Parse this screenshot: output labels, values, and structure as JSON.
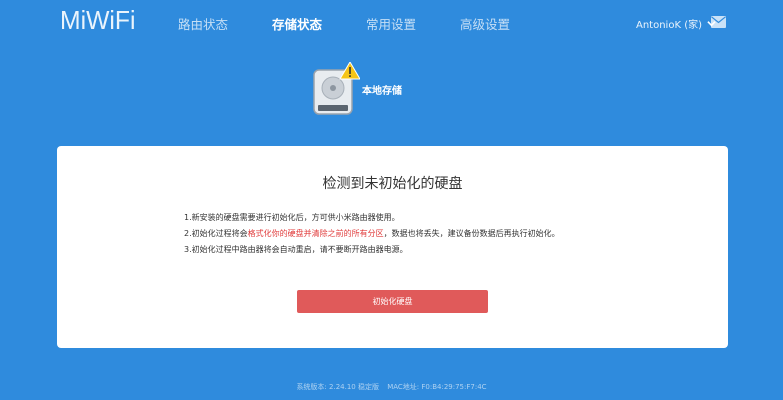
{
  "header": {
    "logo": "MiWiFi",
    "nav": [
      {
        "label": "路由状态",
        "active": false
      },
      {
        "label": "存储状态",
        "active": true
      },
      {
        "label": "常用设置",
        "active": false
      },
      {
        "label": "高级设置",
        "active": false
      }
    ],
    "user_label": "AntonioK (家)"
  },
  "storage": {
    "label": "本地存储"
  },
  "card": {
    "title": "检测到未初始化的硬盘",
    "notes": [
      {
        "before": "1.新安装的硬盘需要进行初始化后，方可供小米路由器使用。",
        "highlight": "",
        "after": ""
      },
      {
        "before": "2.初始化过程将会",
        "highlight": "格式化你的硬盘并清除之前的所有分区",
        "after": "，数据也将丢失，建议备份数据后再执行初始化。"
      },
      {
        "before": "3.初始化过程中路由器将会自动重启，请不要断开路由器电源。",
        "highlight": "",
        "after": ""
      }
    ],
    "button_label": "初始化硬盘"
  },
  "footer": {
    "version": "系统版本: 2.24.10 稳定版",
    "mac": "MAC地址: F0:B4:29:75:F7:4C"
  },
  "colors": {
    "background": "#2f8bdd",
    "card": "#ffffff",
    "button": "#e05a5a",
    "warning_text": "#e03a3a",
    "disk_warning": "#f5c518"
  },
  "icons": [
    "chevron-down-icon",
    "mail-icon",
    "disk-warning-icon"
  ]
}
